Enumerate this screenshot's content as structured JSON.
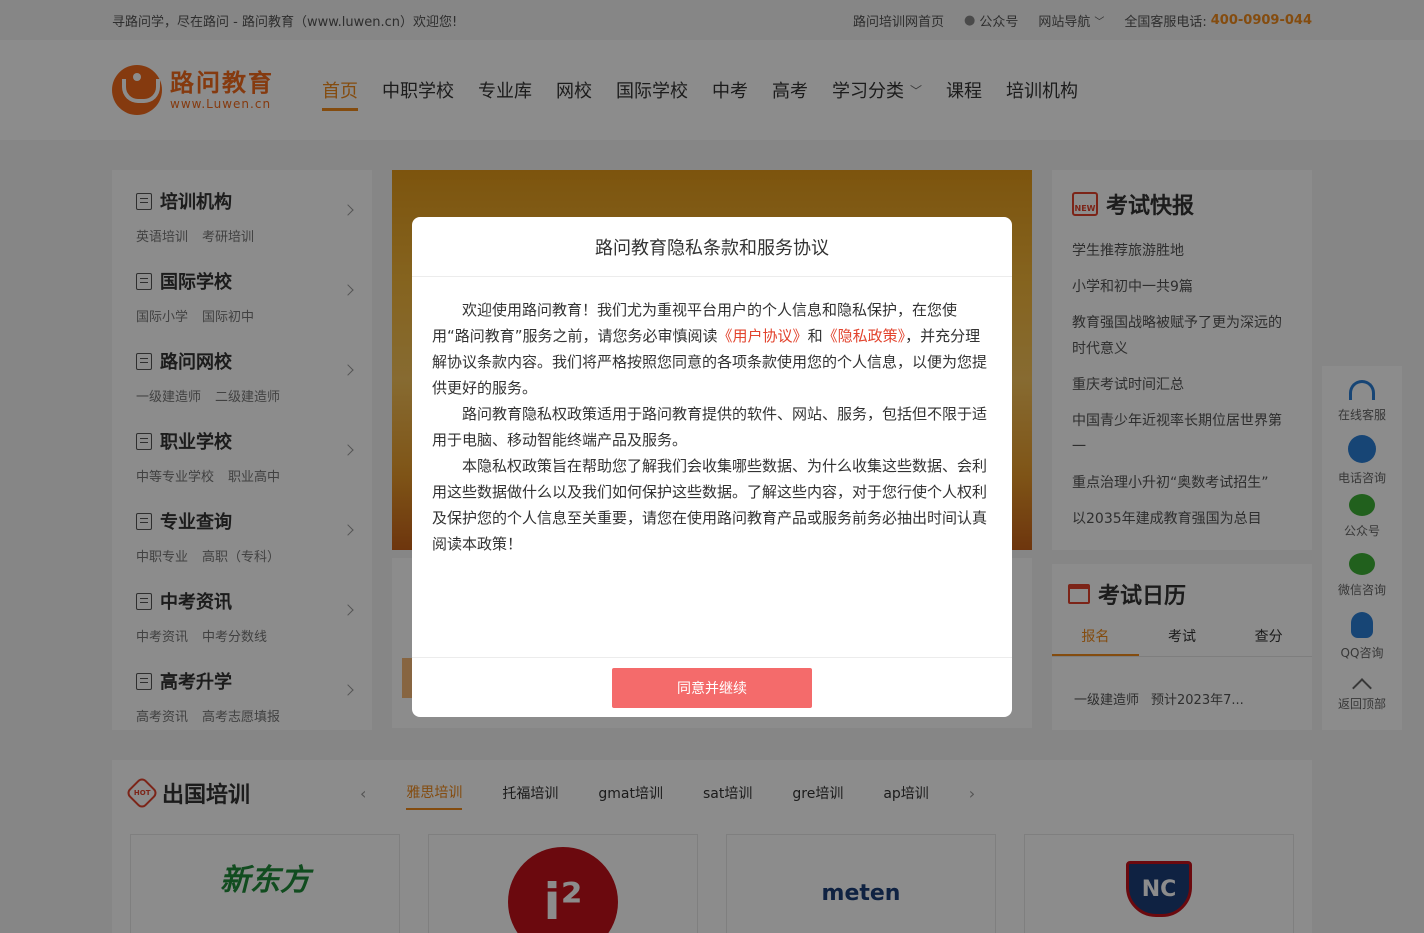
{
  "topbar": {
    "welcome": "寻路问学，尽在路问 - 路问教育（www.luwen.cn）欢迎您!",
    "home_link": "路问培训网首页",
    "wechat": "公众号",
    "site_nav": "网站导航",
    "hotline_label": "全国客服电话:",
    "hotline": "400-0909-044"
  },
  "logo": {
    "cn": "路问教育",
    "en": "www.Luwen.cn"
  },
  "nav": [
    {
      "label": "首页"
    },
    {
      "label": "中职学校"
    },
    {
      "label": "专业库"
    },
    {
      "label": "网校"
    },
    {
      "label": "国际学校"
    },
    {
      "label": "中考"
    },
    {
      "label": "高考"
    },
    {
      "label": "学习分类"
    },
    {
      "label": "课程"
    },
    {
      "label": "培训机构"
    }
  ],
  "sidebar": [
    {
      "title": "培训机构",
      "subs": [
        "英语培训",
        "考研培训"
      ]
    },
    {
      "title": "国际学校",
      "subs": [
        "国际小学",
        "国际初中"
      ]
    },
    {
      "title": "路问网校",
      "subs": [
        "一级建造师",
        "二级建造师"
      ]
    },
    {
      "title": "职业学校",
      "subs": [
        "中等专业学校",
        "职业高中"
      ]
    },
    {
      "title": "专业查询",
      "subs": [
        "中职专业",
        "高职（专科）"
      ]
    },
    {
      "title": "中考资讯",
      "subs": [
        "中考资讯",
        "中考分数线"
      ]
    },
    {
      "title": "高考升学",
      "subs": [
        "高考资讯",
        "高考志愿填报"
      ]
    }
  ],
  "news": {
    "title": "考试快报",
    "badge": "NEW",
    "items": [
      "学生推荐旅游胜地",
      "小学和初中一共9篇",
      "教育强国战略被赋予了更为深远的时代意义",
      "重庆考试时间汇总",
      "中国青少年近视率长期位居世界第一",
      "重点治理小升初“奥数考试招生”",
      "以2035年建成教育强国为总目"
    ]
  },
  "calendar": {
    "title": "考试日历",
    "tabs": [
      "报名",
      "考试",
      "查分"
    ],
    "row_name": "一级建造师",
    "row_value": "预计2023年7..."
  },
  "floatbar": [
    {
      "label": "在线客服",
      "icon": "headset-icon"
    },
    {
      "label": "电话咨询",
      "icon": "phone-icon"
    },
    {
      "label": "公众号",
      "icon": "wechat-icon"
    },
    {
      "label": "微信咨询",
      "icon": "wechat-icon"
    },
    {
      "label": "QQ咨询",
      "icon": "qq-icon"
    },
    {
      "label": "返回顶部",
      "icon": "back-to-top-icon"
    }
  ],
  "abroad": {
    "title": "出国培训",
    "badge": "HOT",
    "tabs": [
      "雅思培训",
      "托福培训",
      "gmat培训",
      "sat培训",
      "gre培训",
      "ap培训"
    ],
    "cards": [
      "新东方",
      "i²",
      "meten",
      "NC"
    ]
  },
  "modal": {
    "title": "路问教育隐私条款和服务协议",
    "p1_a": "欢迎使用路问教育！我们尤为重视平台用户的个人信息和隐私保护，在您使用“路问教育”服务之前，请您务必审慎阅读",
    "link_user": "《用户协议》",
    "p1_and": "和",
    "link_privacy": "《隐私政策》",
    "p1_b": "，并充分理解协议条款内容。我们将严格按照您同意的各项条款使用您的个人信息，以便为您提供更好的服务。",
    "p2": "路问教育隐私权政策适用于路问教育提供的软件、网站、服务，包括但不限于适用于电脑、移动智能终端产品及服务。",
    "p3": "本隐私权政策旨在帮助您了解我们会收集哪些数据、为什么收集这些数据、会利用这些数据做什么以及我们如何保护这些数据。了解这些内容，对于您行使个人权利及保护您的个人信息至关重要，请您在使用路问教育产品或服务前务必抽出时间认真阅读本政策！",
    "agree": "同意并继续"
  },
  "colors": {
    "accent": "#f08a1c",
    "brand": "#f36b1c",
    "link": "#e2432d",
    "agree_button": "#f46b6b"
  }
}
